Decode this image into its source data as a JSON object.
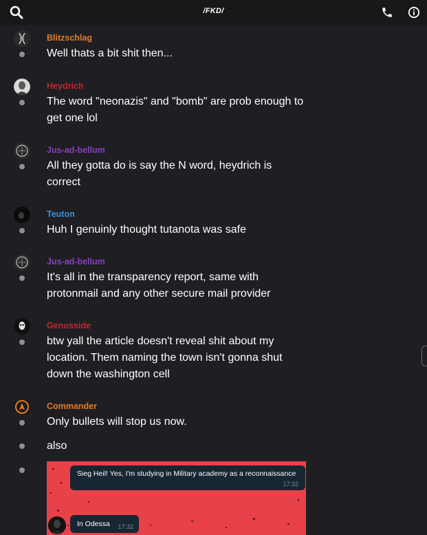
{
  "header": {
    "title": "/FKD/",
    "search_icon": "search-icon",
    "call_icon": "phone-icon",
    "info_icon": "info-icon"
  },
  "messages": [
    {
      "sender": "Blitzschlag",
      "color": "#e07b2a",
      "lines": [
        "Well thats a bit shit then..."
      ]
    },
    {
      "sender": "Heydrich",
      "color": "#c0272d",
      "lines": [
        "The word \"neonazis\" and \"bomb\" are prob enough to",
        "get one lol"
      ]
    },
    {
      "sender": "Jus-ad-bellum",
      "color": "#8a3fbf",
      "lines": [
        "All they gotta do is say the N word, heydrich is",
        "correct"
      ]
    },
    {
      "sender": "Teuton",
      "color": "#3a8fd6",
      "lines": [
        "Huh I genuinly thought tutanota was safe"
      ]
    },
    {
      "sender": "Jus-ad-bellum",
      "color": "#8a3fbf",
      "lines": [
        "It's all in the transparency report, same with",
        "protonmail and any other secure mail provider"
      ]
    },
    {
      "sender": "Genosside",
      "color": "#c0272d",
      "lines": [
        "btw yall the article doesn't reveal shit about my",
        "location. Them naming the town isn't gonna shut",
        "down the washington cell"
      ]
    },
    {
      "sender": "Commander",
      "color": "#e07b2a",
      "lines": [
        "Only bullets will stop us now."
      ]
    },
    {
      "sender": "",
      "color": "",
      "lines": [
        "also"
      ]
    }
  ],
  "embed": {
    "bubble1_text": "Sieg Heil! Yes, I'm studying in Military academy as a reconnaissance",
    "bubble1_time": "17:32",
    "bubble2_text": "In Odessa",
    "bubble2_time": "17:32"
  }
}
